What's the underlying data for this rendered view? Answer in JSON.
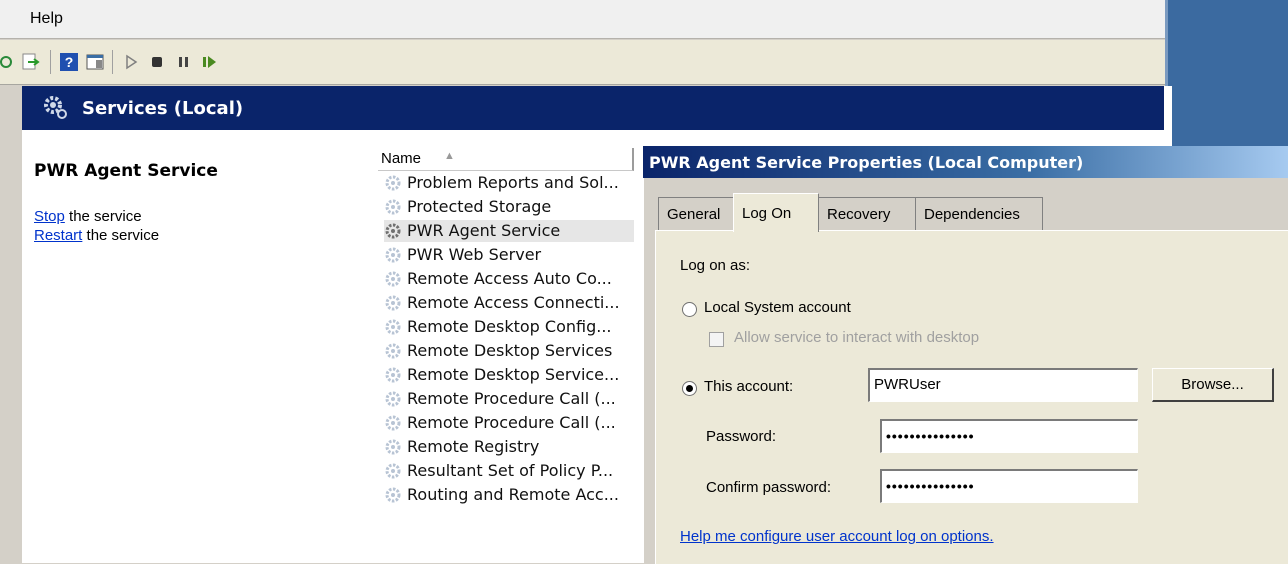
{
  "menubar": {
    "help_label": "Help"
  },
  "toolbar": {
    "buttons": [
      "refresh-icon",
      "export-list-icon",
      "help-icon",
      "show-hide-pane-icon",
      "start-service-icon",
      "stop-service-icon",
      "pause-service-icon",
      "resume-service-icon"
    ]
  },
  "snapin": {
    "title": "Services (Local)",
    "selected_service": "PWR Agent Service",
    "actions": [
      {
        "link": "Stop",
        "rest": " the service"
      },
      {
        "link": "Restart",
        "rest": " the service"
      }
    ]
  },
  "list": {
    "column_name": "Name",
    "sort_glyph": "▲",
    "rows": [
      "Problem Reports and Sol...",
      "Protected Storage",
      "PWR Agent Service",
      "PWR Web Server",
      "Remote Access Auto Co...",
      "Remote Access Connecti...",
      "Remote Desktop Config...",
      "Remote Desktop Services",
      "Remote Desktop Service...",
      "Remote Procedure Call (...",
      "Remote Procedure Call (...",
      "Remote Registry",
      "Resultant Set of Policy P...",
      "Routing and Remote Acc..."
    ],
    "selected_index": 2
  },
  "dialog": {
    "title": "PWR Agent Service Properties (Local Computer)",
    "tabs": [
      "General",
      "Log On",
      "Recovery",
      "Dependencies"
    ],
    "active_tab": "Log On",
    "log_on_as": "Log on as:",
    "local_system": "Local System account",
    "allow_interact": "Allow service to interact with desktop",
    "this_account": "This account:",
    "account_value": "PWRUser",
    "browse": "Browse...",
    "password_label": "Password:",
    "password_value": "•••••••••••••••",
    "confirm_label": "Confirm password:",
    "confirm_value": "•••••••••••••••",
    "help_link": "Help me configure user account log on options."
  },
  "colors": {
    "header_blue": "#0a246a",
    "dialog_face": "#ece9d8",
    "link_blue": "#0033cc"
  }
}
